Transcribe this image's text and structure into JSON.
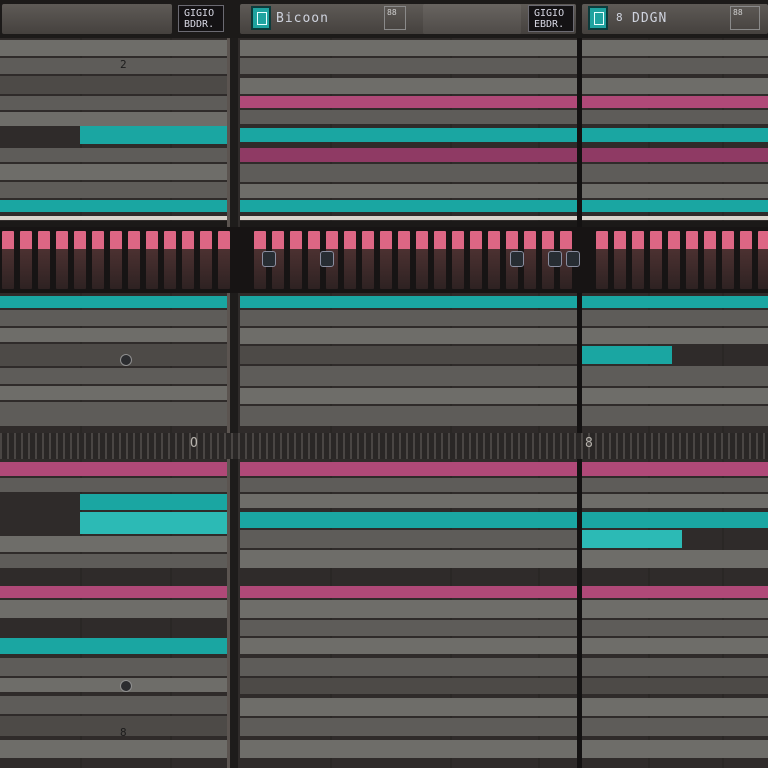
{
  "header": {
    "left_button": {
      "line1": "GIGIO",
      "line2": "BDDR."
    },
    "title": "Bicoon",
    "center_button": {
      "line1": "GIGIO",
      "line2": "EBDR."
    },
    "right_label": "DDGN",
    "tiny_glyph": "8",
    "mini_left": "88",
    "mini_right": "88"
  },
  "ruler": {
    "label_left": "O",
    "label_right": "8"
  },
  "markers": [
    "2",
    "?",
    "8"
  ],
  "colors": {
    "pink": "#b04978",
    "teal": "#1aa6a2",
    "gray": "#6e6d69",
    "background": "#2f2b2a"
  }
}
